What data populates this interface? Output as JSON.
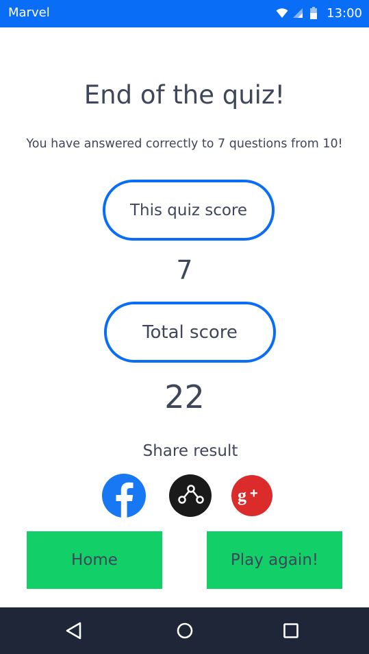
{
  "status_bar": {
    "app_name": "Marvel",
    "time": "13:00",
    "background_color": "#0a6df5",
    "icons": [
      "wifi-icon",
      "signal-icon",
      "battery-icon"
    ]
  },
  "result": {
    "title": "End of the quiz!",
    "summary": "You have answered correctly to 7 questions from 10!",
    "quiz_score_label": "This quiz score",
    "quiz_score_value": "7",
    "total_score_label": "Total score",
    "total_score_value": "22"
  },
  "share": {
    "label": "Share result",
    "icons": [
      "facebook-icon",
      "share-icon",
      "google-plus-icon"
    ]
  },
  "actions": {
    "home_label": "Home",
    "play_again_label": "Play again!",
    "button_color": "#12cf68"
  },
  "nav_bar": {
    "icons": [
      "back-icon",
      "home-icon",
      "recent-apps-icon"
    ],
    "background_color": "#1e2637"
  },
  "colors": {
    "accent": "#0a6df5",
    "text": "#3d4759"
  }
}
